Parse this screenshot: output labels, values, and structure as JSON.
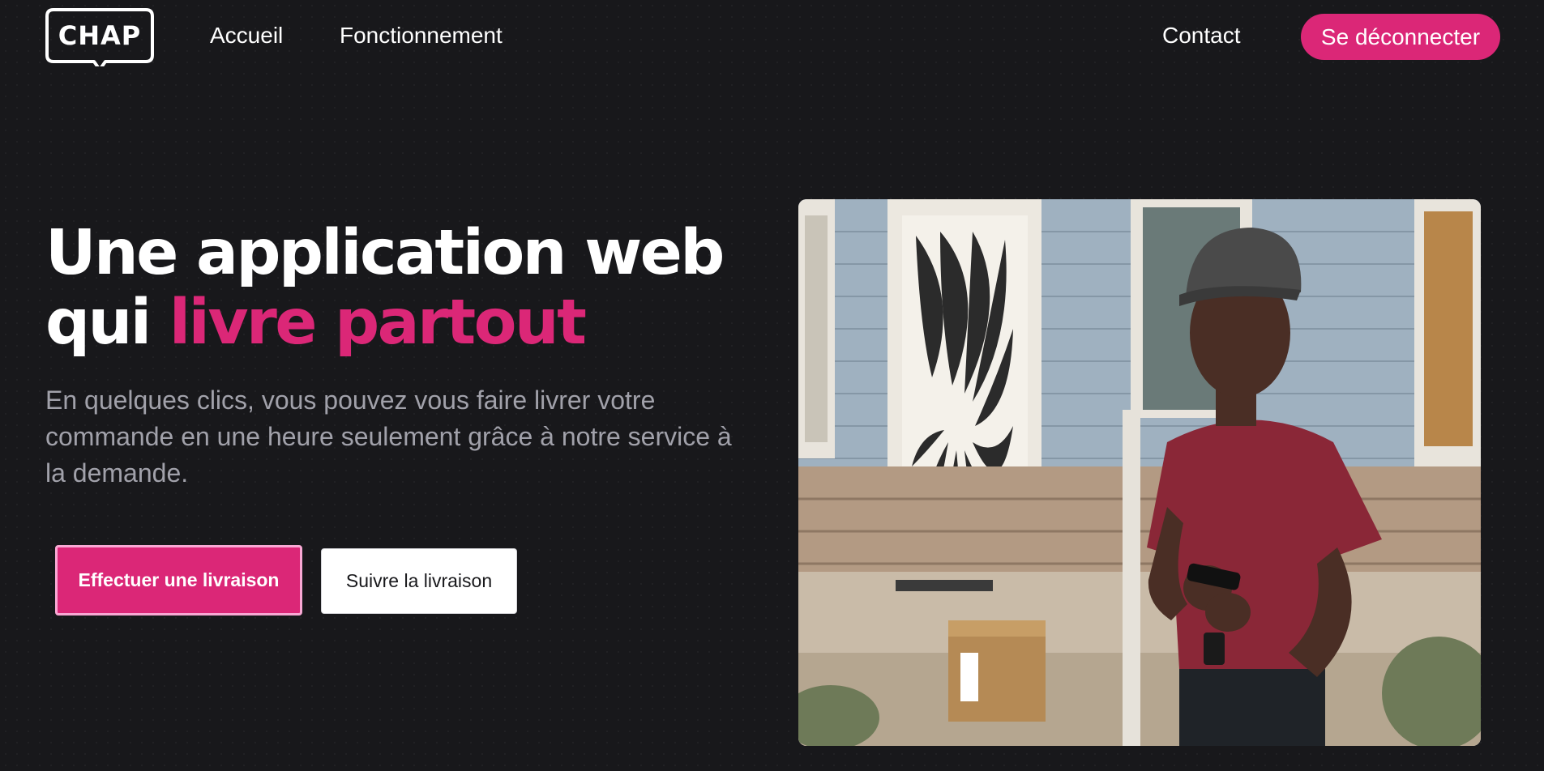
{
  "brand": {
    "logo_text": "CHAP"
  },
  "nav": {
    "accueil": "Accueil",
    "fonctionnement": "Fonctionnement",
    "contact": "Contact",
    "logout": "Se déconnecter"
  },
  "hero": {
    "title_line1": "Une application web",
    "title_line2_prefix": "qui ",
    "title_line2_accent": "livre partout",
    "subtitle": "En quelques clics, vous pouvez vous faire livrer votre commande en une heure seulement grâce à notre service à la demande.",
    "primary_cta": "Effectuer une livraison",
    "secondary_cta": "Suivre la livraison",
    "image_subject": "delivery-man-with-phone-and-parcel"
  },
  "colors": {
    "background": "#18181b",
    "accent": "#db2777",
    "accent_border": "#f9a8d4",
    "subtitle": "#a1a1aa"
  }
}
